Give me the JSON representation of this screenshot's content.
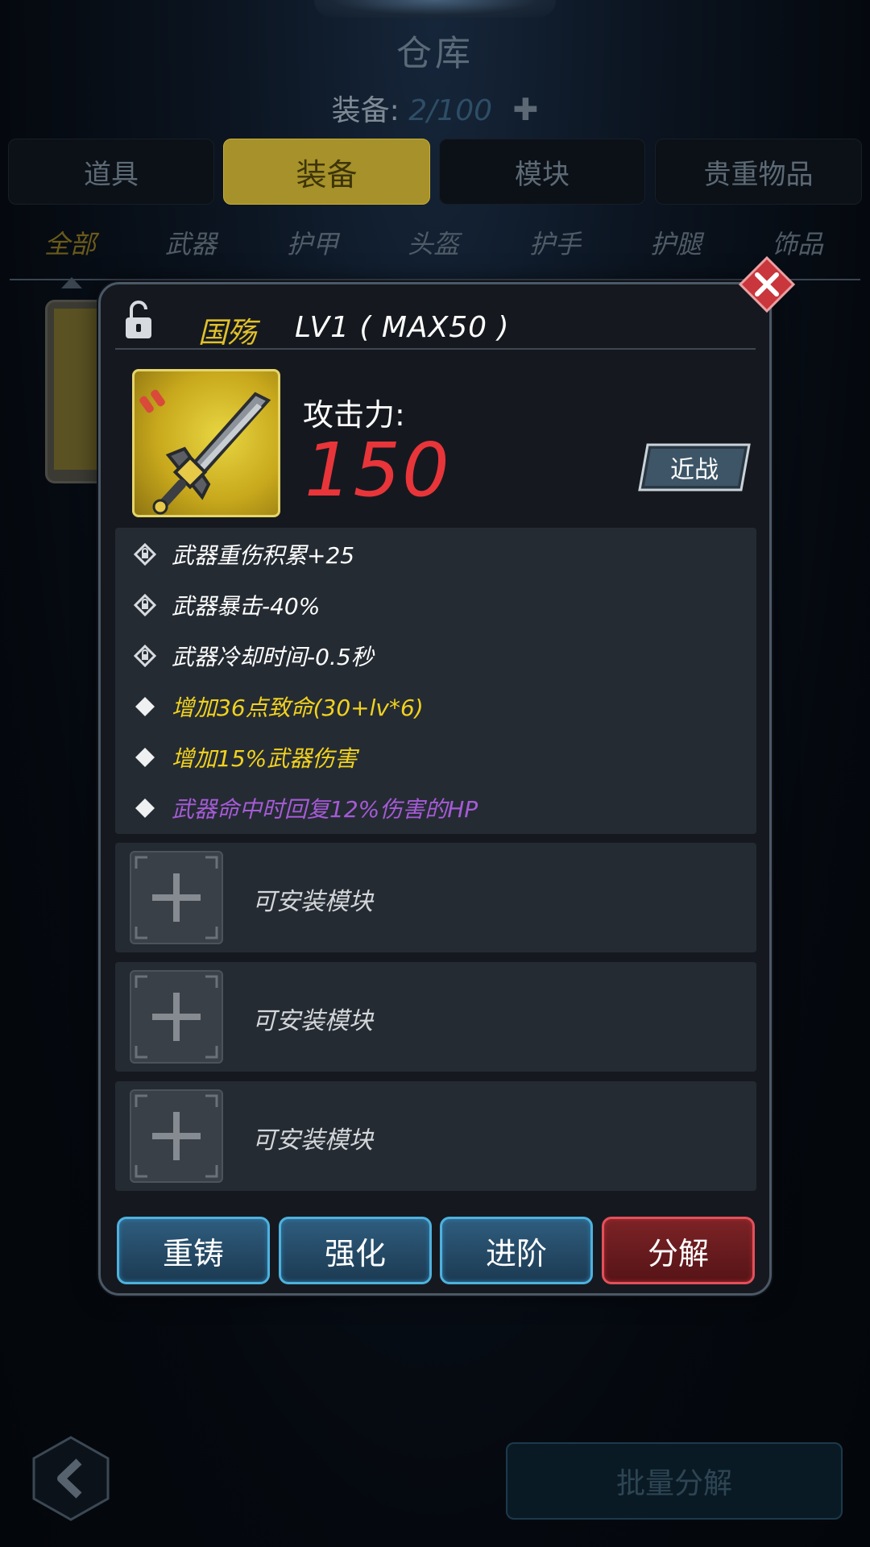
{
  "header": {
    "title": "仓库",
    "capacity_label": "装备:",
    "capacity_value": "2/100",
    "capacity_add_icon": "plus-icon"
  },
  "tabs": [
    {
      "label": "道具",
      "active": false
    },
    {
      "label": "装备",
      "active": true
    },
    {
      "label": "模块",
      "active": false
    },
    {
      "label": "贵重物品",
      "active": false
    }
  ],
  "subtabs": [
    {
      "label": "全部",
      "active": true
    },
    {
      "label": "武器",
      "active": false
    },
    {
      "label": "护甲",
      "active": false
    },
    {
      "label": "头盔",
      "active": false
    },
    {
      "label": "护手",
      "active": false
    },
    {
      "label": "护腿",
      "active": false
    },
    {
      "label": "饰品",
      "active": false
    }
  ],
  "dialog": {
    "lock_icon": "unlocked-padlock-icon",
    "item_name": "国殇",
    "item_level": "LV1 ( MAX50 )",
    "item_icon": "sword-icon",
    "attack_label": "攻击力:",
    "attack_value": "150",
    "type_badge": "近战",
    "stats": [
      {
        "text": "武器重伤积累+25",
        "color": "#ffffff",
        "icon": "lock-diamond-icon"
      },
      {
        "text": "武器暴击-40%",
        "color": "#ffffff",
        "icon": "lock-diamond-icon"
      },
      {
        "text": "武器冷却时间-0.5秒",
        "color": "#ffffff",
        "icon": "lock-diamond-icon"
      },
      {
        "text": "增加36点致命(30+lv*6)",
        "color": "#f1d21f",
        "icon": "diamond-icon"
      },
      {
        "text": "增加15%武器伤害",
        "color": "#f1d21f",
        "icon": "diamond-icon"
      },
      {
        "text": "武器命中时回复12%伤害的HP",
        "color": "#a55bd6",
        "icon": "diamond-icon"
      }
    ],
    "module_slots": [
      {
        "label": "可安装模块"
      },
      {
        "label": "可安装模块"
      },
      {
        "label": "可安装模块"
      }
    ],
    "actions": {
      "reforge": "重铸",
      "enhance": "强化",
      "advance": "进阶",
      "dismantle": "分解"
    }
  },
  "footer": {
    "back_icon": "chevron-left-icon",
    "batch_dismantle": "批量分解"
  },
  "colors": {
    "active_tab": "#a6912a",
    "attack_value": "#e8353a",
    "item_name": "#e2c12a",
    "blue_button_border": "#4fb1dd",
    "red_button_border": "#e3505a"
  }
}
